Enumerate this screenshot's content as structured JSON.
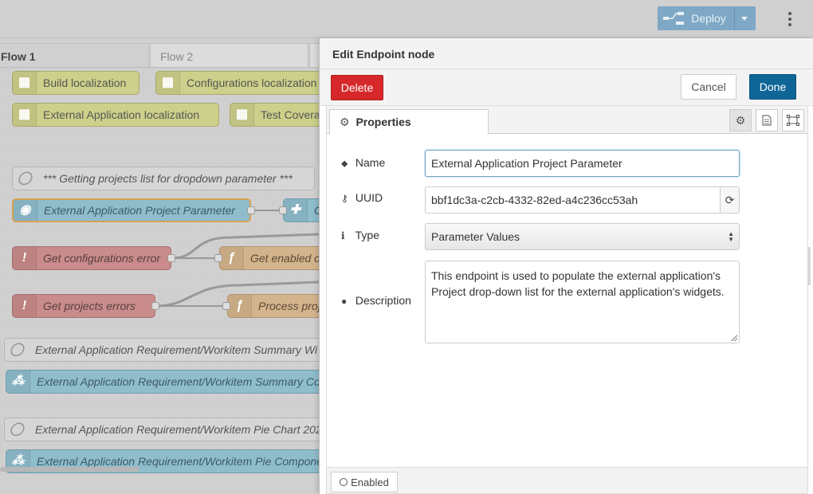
{
  "header": {
    "deploy_label": "Deploy"
  },
  "workspace": {
    "tabs": [
      {
        "label": "Flow 1",
        "active": true
      },
      {
        "label": "Flow 2",
        "active": false
      }
    ],
    "nodes": {
      "build_localization": "Build localization",
      "configurations_localization": "Configurations localization",
      "external_app_localization": "External Application localization",
      "test_coverage": "Test Covera",
      "getting_projects_comment": "*** Getting projects list for dropdown parameter ***",
      "endpoint_node": "External Application Project Parameter",
      "get_config_error": "Get configurations error",
      "get_enabled": "Get enabled c",
      "get_projects_errors": "Get projects errors",
      "process_proj": "Process proj",
      "summary_comment": "External Application Requirement/Workitem Summary Wi",
      "summary_component": "External Application Requirement/Workitem Summary Co",
      "pie_chart_comment": "External Application Requirement/Workitem Pie Chart 202",
      "pie_component": "External Application Requirement/Workitem Pie Compone",
      "blue_partial": "G"
    }
  },
  "editor": {
    "title": "Edit Endpoint node",
    "delete_label": "Delete",
    "cancel_label": "Cancel",
    "done_label": "Done",
    "properties_tab": "Properties",
    "fields": {
      "name_label": "Name",
      "name_value": "External Application Project Parameter",
      "uuid_label": "UUID",
      "uuid_value": "bbf1dc3a-c2cb-4332-82ed-a4c236cc53ah",
      "type_label": "Type",
      "type_value": "Parameter Values",
      "description_label": "Description",
      "description_value": "This endpoint is used to populate the external application's Project drop-down list for the external application's widgets."
    },
    "enabled_label": "Enabled"
  },
  "colors": {
    "deploy": "#7fa8c6",
    "delete": "#d6282a",
    "done": "#0f6596",
    "selected_node_border": "#d7a052"
  }
}
